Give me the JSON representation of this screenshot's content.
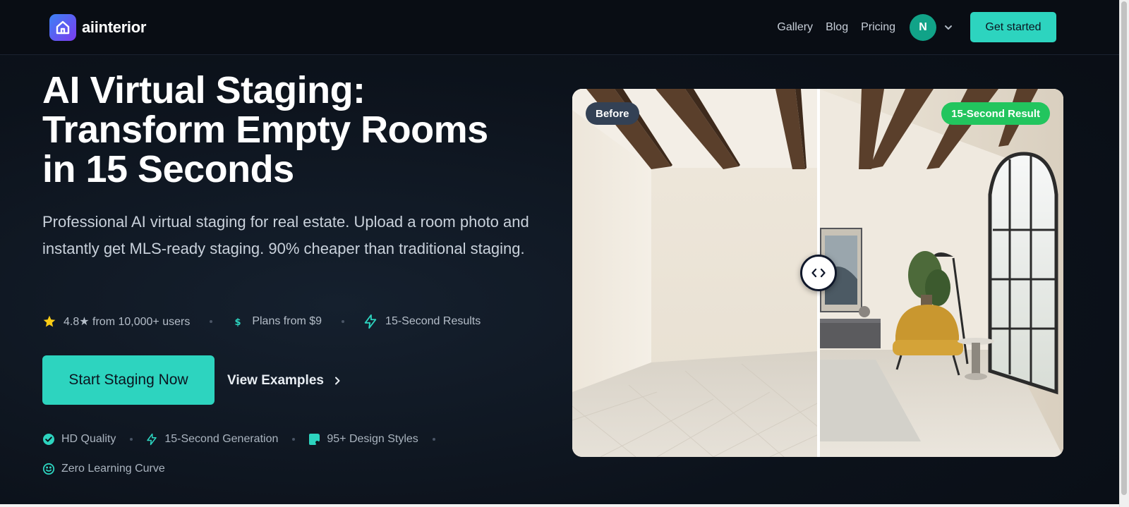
{
  "brand": {
    "name": "aiinterior"
  },
  "nav": {
    "links": [
      "Gallery",
      "Blog",
      "Pricing"
    ],
    "avatar_initial": "N",
    "cta": "Get started"
  },
  "hero": {
    "title_lines": [
      "AI Virtual Staging:",
      "Transform Empty Rooms",
      "in 15 Seconds"
    ],
    "subtitle": "Professional AI virtual staging for real estate. Upload a room photo and instantly get MLS-ready staging. 90% cheaper than traditional staging.",
    "stats": [
      {
        "icon": "star-icon",
        "label": "4.8★ from 10,000+ users"
      },
      {
        "icon": "dollar-icon",
        "label": "Plans from $9"
      },
      {
        "icon": "lightning-icon",
        "label": "15-Second Results"
      }
    ],
    "primary_cta": "Start Staging Now",
    "secondary_cta": "View Examples",
    "features": [
      {
        "icon": "check-circle-icon",
        "label": "HD Quality"
      },
      {
        "icon": "lightning-icon",
        "label": "15-Second Generation"
      },
      {
        "icon": "palette-icon",
        "label": "95+ Design Styles"
      },
      {
        "icon": "smile-icon",
        "label": "Zero Learning Curve"
      }
    ]
  },
  "compare": {
    "before_label": "Before",
    "after_label": "15-Second Result",
    "slider_position": 0.5
  },
  "colors": {
    "accent": "#2dd4bf",
    "background": "#0c121b",
    "after_badge": "#22c55e",
    "before_badge": "#334155",
    "star": "#facc15"
  }
}
